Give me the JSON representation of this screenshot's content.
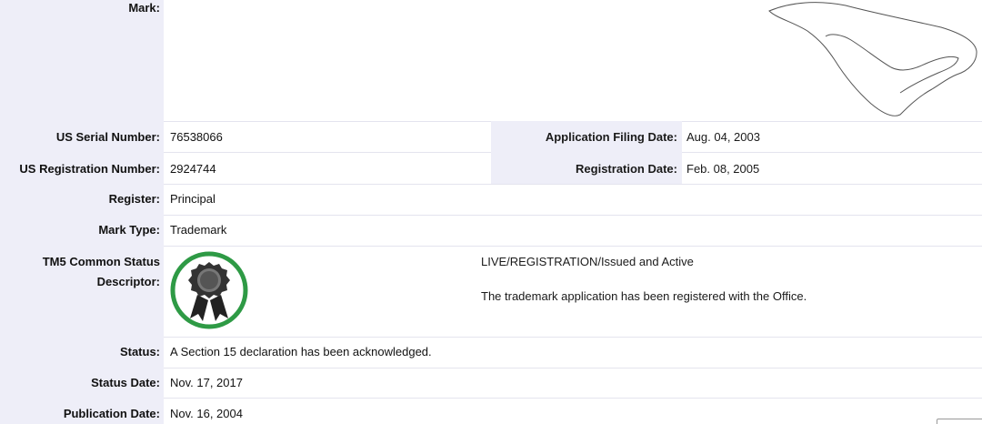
{
  "mark": {
    "label": "Mark:"
  },
  "serial": {
    "label": "US Serial Number:",
    "value": "76538066"
  },
  "filing": {
    "label": "Application Filing Date:",
    "value": "Aug. 04, 2003"
  },
  "registration_number": {
    "label": "US Registration Number:",
    "value": "2924744"
  },
  "registration_date": {
    "label": "Registration Date:",
    "value": "Feb. 08, 2005"
  },
  "register": {
    "label": "Register:",
    "value": "Principal"
  },
  "mark_type": {
    "label": "Mark Type:",
    "value": "Trademark"
  },
  "tm5": {
    "label_line1": "TM5 Common Status",
    "label_line2": "Descriptor:",
    "icon": "ribbon-award-icon",
    "status_line": "LIVE/REGISTRATION/Issued and Active",
    "description": "The trademark application has been registered with the Office.",
    "icon_color": "#2e9a45"
  },
  "status": {
    "label": "Status:",
    "value": "A Section 15 declaration has been acknowledged."
  },
  "status_date": {
    "label": "Status Date:",
    "value": "Nov. 17, 2017"
  },
  "publication_date": {
    "label": "Publication Date:",
    "value": "Nov. 16, 2004"
  }
}
